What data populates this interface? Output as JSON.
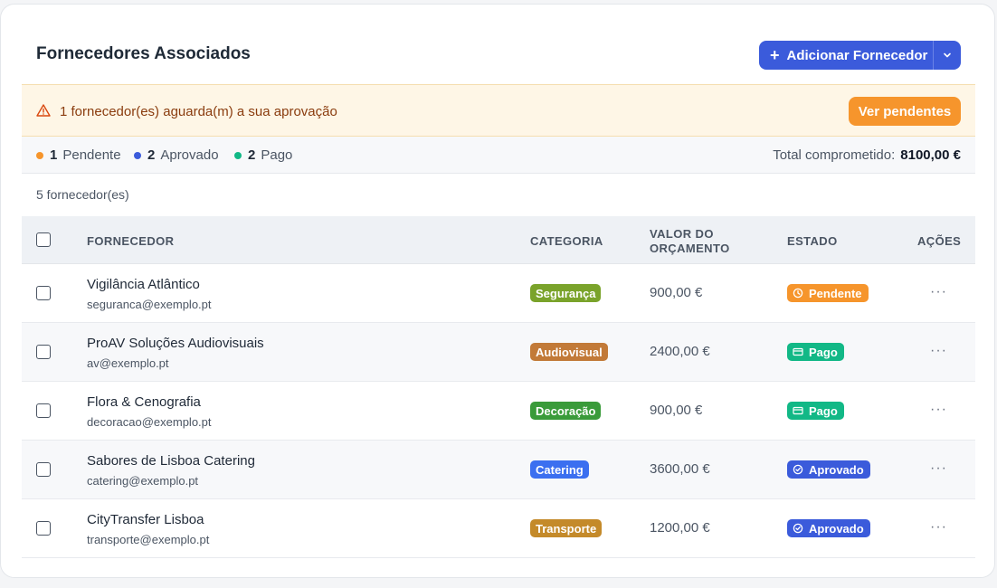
{
  "header": {
    "title": "Fornecedores Associados",
    "add_label": "Adicionar Fornecedor"
  },
  "alert": {
    "message": "1 fornecedor(es) aguarda(m) a sua aprovação",
    "button_label": "Ver pendentes"
  },
  "summary": {
    "stats": [
      {
        "count": "1",
        "label": "Pendente",
        "color": "#f6952c"
      },
      {
        "count": "2",
        "label": "Aprovado",
        "color": "#3b5bdb"
      },
      {
        "count": "2",
        "label": "Pago",
        "color": "#12b886"
      }
    ],
    "total_label": "Total comprometido:",
    "total_value": "8100,00 €"
  },
  "count_text": "5 fornecedor(es)",
  "table": {
    "columns": {
      "supplier": "FORNECEDOR",
      "category": "CATEGORIA",
      "budget_line1": "VALOR DO",
      "budget_line2": "ORÇAMENTO",
      "state": "ESTADO",
      "actions": "AÇÕES"
    },
    "rows": [
      {
        "name": "Vigilância Atlântico",
        "email": "seguranca@exemplo.pt",
        "category": "Segurança",
        "category_color": "#7aa32b",
        "value": "900,00 €",
        "state": "Pendente",
        "state_color": "#f6952c",
        "state_icon": "clock-icon"
      },
      {
        "name": "ProAV Soluções Audiovisuais",
        "email": "av@exemplo.pt",
        "category": "Audiovisual",
        "category_color": "#c27a38",
        "value": "2400,00 €",
        "state": "Pago",
        "state_color": "#12b886",
        "state_icon": "card-icon"
      },
      {
        "name": "Flora & Cenografia",
        "email": "decoracao@exemplo.pt",
        "category": "Decoração",
        "category_color": "#3a9b3a",
        "value": "900,00 €",
        "state": "Pago",
        "state_color": "#12b886",
        "state_icon": "card-icon"
      },
      {
        "name": "Sabores de Lisboa Catering",
        "email": "catering@exemplo.pt",
        "category": "Catering",
        "category_color": "#3b6ff0",
        "value": "3600,00 €",
        "state": "Aprovado",
        "state_color": "#3b5bdb",
        "state_icon": "check-circle-icon"
      },
      {
        "name": "CityTransfer Lisboa",
        "email": "transporte@exemplo.pt",
        "category": "Transporte",
        "category_color": "#c48a2a",
        "value": "1200,00 €",
        "state": "Aprovado",
        "state_color": "#3b5bdb",
        "state_icon": "check-circle-icon"
      }
    ],
    "actions_glyph": "···"
  }
}
